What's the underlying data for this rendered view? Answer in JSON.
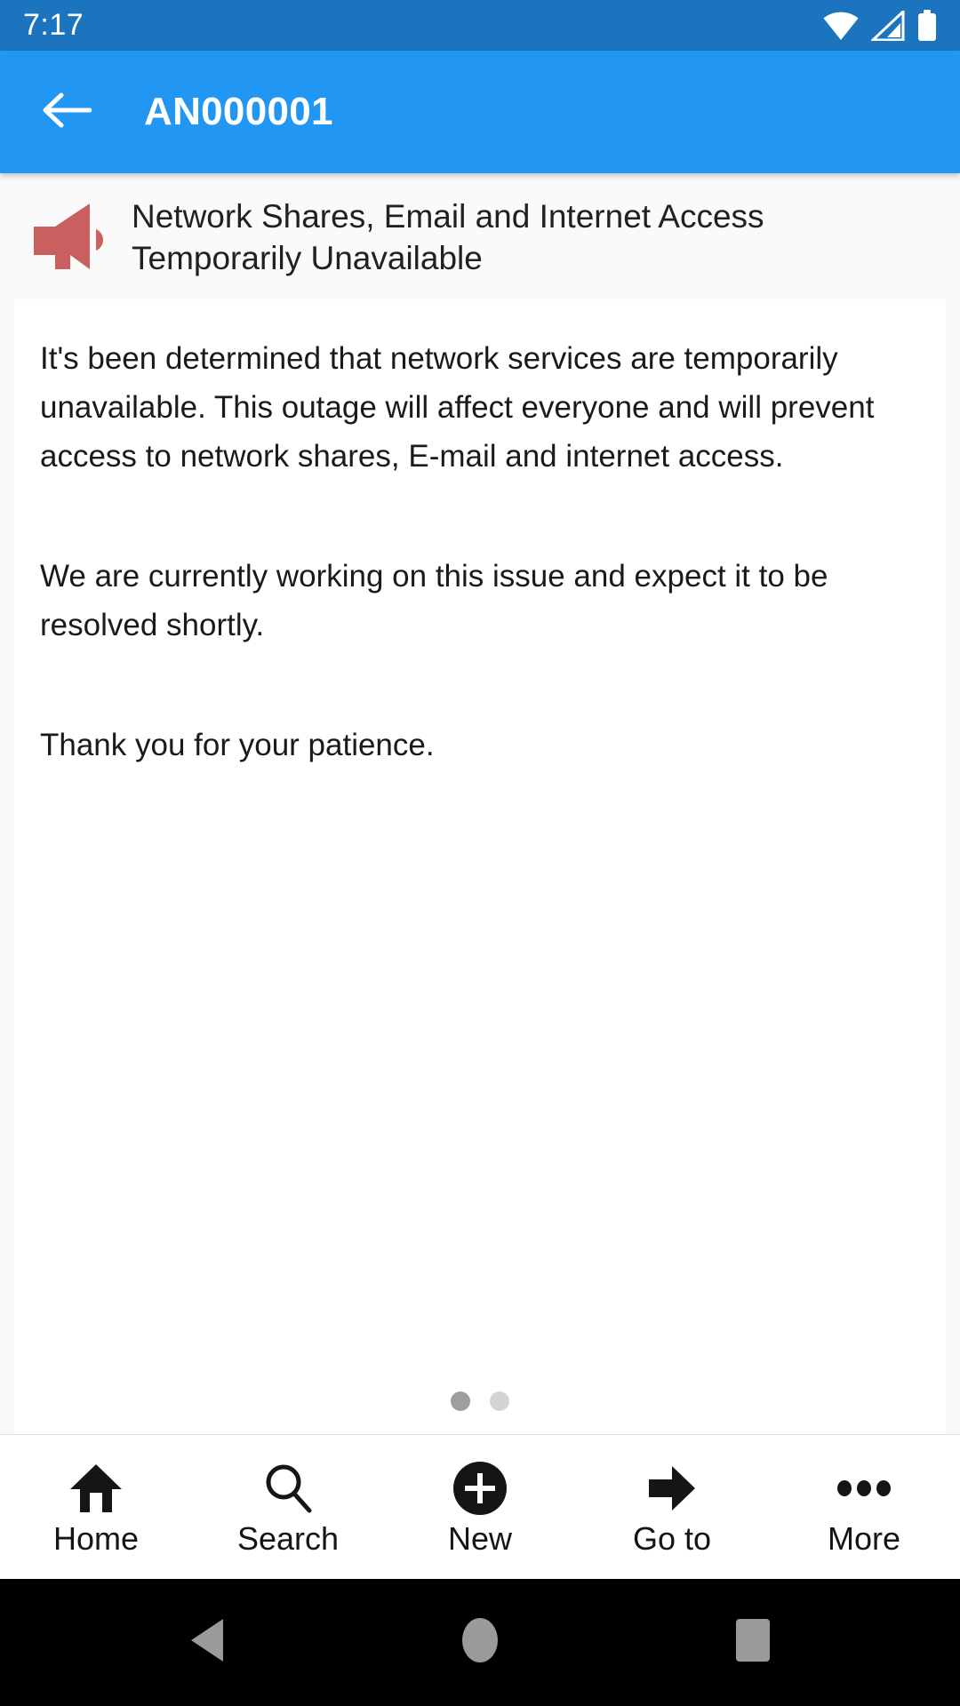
{
  "status_bar": {
    "time": "7:17",
    "icons": [
      "wifi-icon",
      "cellular-signal-icon",
      "battery-icon"
    ],
    "background_color": "#1b74bd"
  },
  "app_bar": {
    "back_label": "back-arrow-icon",
    "title": "AN000001",
    "background_color": "#2196f3",
    "text_color": "#ffffff"
  },
  "announcement": {
    "icon": "megaphone-icon",
    "icon_color": "#c9605f",
    "title": "Network Shares, Email and Internet Access Temporarily Unavailable",
    "body": [
      "It's been determined that network services are temporarily unavailable. This outage will affect everyone and will prevent access to network shares, E-mail and internet access.",
      "We are currently working on this issue and expect it to be resolved shortly.",
      "Thank you for your patience."
    ]
  },
  "page_indicator": {
    "total": 2,
    "active_index": 0,
    "active_color": "#9e9e9e",
    "inactive_color": "#d4d4d4"
  },
  "tab_bar": {
    "items": [
      {
        "label": "Home",
        "icon": "home-icon"
      },
      {
        "label": "Search",
        "icon": "search-icon"
      },
      {
        "label": "New",
        "icon": "plus-circle-icon"
      },
      {
        "label": "Go to",
        "icon": "arrow-right-icon"
      },
      {
        "label": "More",
        "icon": "ellipsis-icon"
      }
    ]
  },
  "navigation_bar": {
    "buttons": [
      "back-triangle-icon",
      "home-circle-icon",
      "recents-square-icon"
    ],
    "icon_color": "#9a9a9a",
    "background_color": "#000000"
  }
}
